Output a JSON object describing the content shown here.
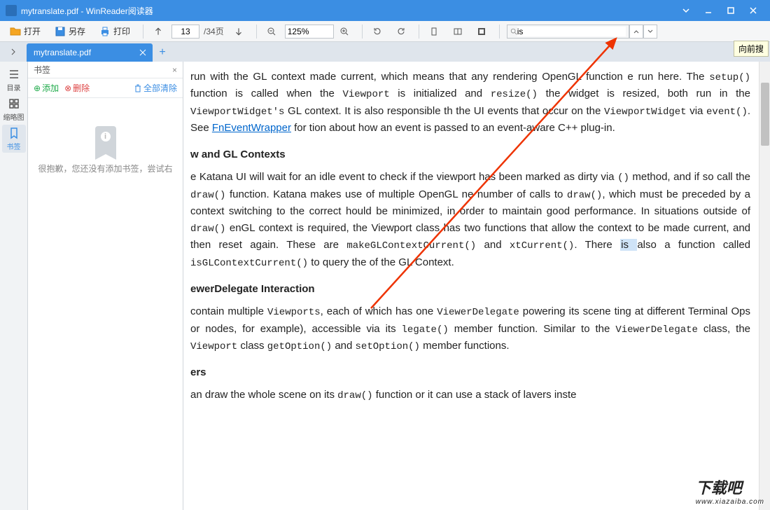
{
  "title": "mytranslate.pdf - WinReader阅读器",
  "toolbar": {
    "open": "打开",
    "save": "另存",
    "print": "打印",
    "page_current": "13",
    "page_total": "/34页",
    "zoom": "125%",
    "search_value": "is",
    "search_hint": "向前搜"
  },
  "tabs": {
    "active": "mytranslate.pdf"
  },
  "sidebar": {
    "catalog": "目录",
    "thumbnails": "缩略图",
    "bookmarks": "书签"
  },
  "bookmark_panel": {
    "title": "书签",
    "add": "添加",
    "delete": "删除",
    "clear_all": "全部清除",
    "empty_msg": "很抱歉，您还没有添加书签，尝试右"
  },
  "doc": {
    "p1a": " run with the GL context made current, which means that any rendering OpenGL function ",
    "p1b": "e run here. The ",
    "c1": "setup()",
    "p1c": " function is called when the ",
    "c2": "Viewport",
    "p1d": " is initialized and ",
    "c3": "resize()",
    "p1e": " the widget is resized, both run in the ",
    "c4": "ViewportWidget's",
    "p1f": " GL context. It is also responsible th the UI events that occur on the ",
    "c5": "ViewportWidget",
    "p1g": " via ",
    "c6": "event()",
    "p1h": ". See ",
    "link1": "FnEventWrapper",
    "p1i": " for tion about how an event is passed to an event-aware C++ plug-in.",
    "h1": "w and GL Contexts",
    "p2a": "e Katana UI will wait for an idle event to check if the viewport has been marked as dirty via ",
    "c7": "()",
    "p2b": " method, and if so call the ",
    "c8": "draw()",
    "p2c": " function. Katana makes use of multiple OpenGL ne number of calls to ",
    "c9": "draw()",
    "p2d": ", which must be preceded by a context switching to the correct hould be minimized, in order to maintain good performance. In situations outside of ",
    "c10": "draw()",
    "p2e": " enGL context is required, the Viewport class has two functions that allow the context to be made current, and then reset again. These are ",
    "c11": "makeGLContextCurrent()",
    "p2f": " and ",
    "c12": "xtCurrent()",
    "p2g": ".  There ",
    "hl1": "is ",
    "p2h": "also a function called ",
    "c13": "isGLContextCurrent()",
    "p2i": " to query the of the GL Context.",
    "h2": "ewerDelegate Interaction",
    "p3a": " contain multiple ",
    "c14": "Viewports",
    "p3b": ", each of which has one ",
    "c15": "ViewerDelegate",
    "p3c": " powering its scene ting at different Terminal Ops or nodes, for example), accessible via its ",
    "c16": "legate()",
    "p3d": " member function. Similar to the ",
    "c17": "ViewerDelegate",
    "p3e": " class, the ",
    "c18": "Viewport",
    "p3f": " class ",
    "c19": "getOption()",
    "p3g": " and ",
    "c20": "setOption()",
    "p3h": " member functions.",
    "h3": "ers",
    "p4a": "an draw the whole scene on its ",
    "c21": "draw()",
    "p4b": " function or it can use a stack of lavers inste"
  },
  "watermark": {
    "main": "下载吧",
    "sub": "www.xiazaiba.com"
  }
}
